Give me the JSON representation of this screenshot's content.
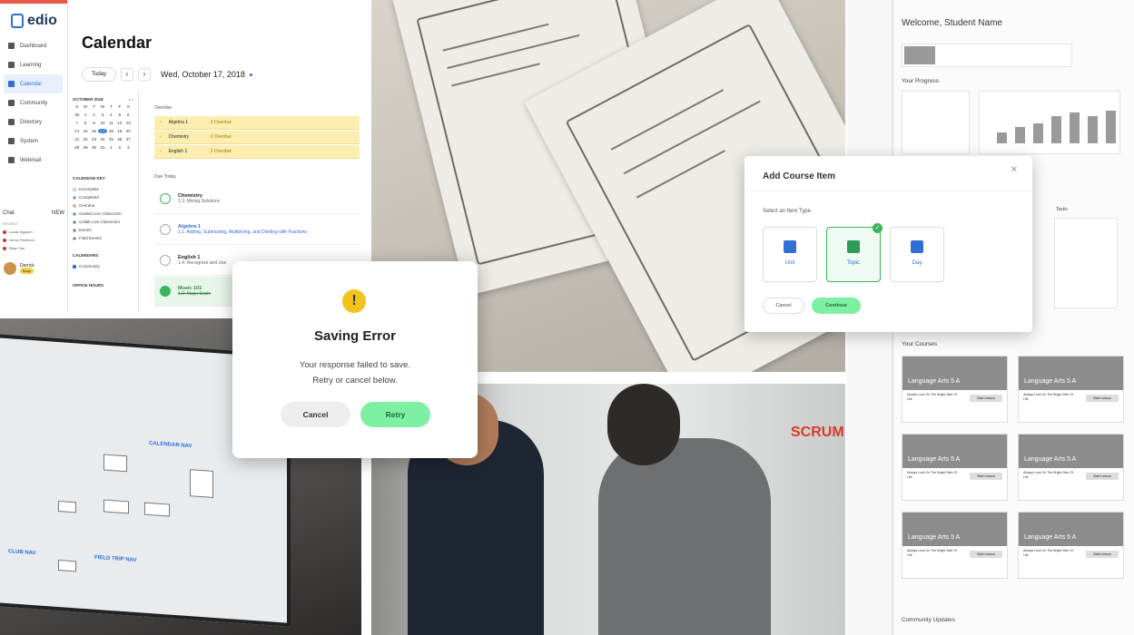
{
  "calendar_app": {
    "brand": "edio",
    "nav": [
      {
        "label": "Dashboard",
        "icon": "dashboard-icon"
      },
      {
        "label": "Learning",
        "icon": "learning-icon"
      },
      {
        "label": "Calendar",
        "icon": "calendar-icon",
        "active": true
      },
      {
        "label": "Community",
        "icon": "community-icon"
      },
      {
        "label": "Directory",
        "icon": "directory-icon"
      },
      {
        "label": "System",
        "icon": "system-icon"
      },
      {
        "label": "Webmail",
        "icon": "webmail-icon"
      }
    ],
    "chat": {
      "label": "Chat",
      "badge": "NEW",
      "recent_label": "RECENT",
      "contacts": [
        "Lucas Nguyen",
        "Jenny Peterson",
        "Ryan Yao"
      ]
    },
    "user": {
      "name": "Derrick",
      "status": "Busy"
    },
    "title": "Calendar",
    "today_button": "Today",
    "current_date": "Wed, October 17, 2018",
    "mini_calendar": {
      "month": "OCTOBER 2018",
      "weekdays": [
        "S",
        "M",
        "T",
        "W",
        "T",
        "F",
        "S"
      ],
      "days": [
        "30",
        "1",
        "2",
        "3",
        "4",
        "5",
        "6",
        "7",
        "8",
        "9",
        "10",
        "11",
        "12",
        "13",
        "14",
        "15",
        "16",
        "17",
        "18",
        "19",
        "20",
        "21",
        "22",
        "23",
        "24",
        "25",
        "26",
        "27",
        "28",
        "29",
        "30",
        "31",
        "1",
        "2",
        "3"
      ],
      "selected": "17"
    },
    "calendar_key": {
      "title": "CALENDAR KEY",
      "items": [
        {
          "label": "Incomplete",
          "color": "#ffffff"
        },
        {
          "label": "Completed",
          "color": "#3bb559"
        },
        {
          "label": "Overdue",
          "color": "#f3c21b"
        },
        {
          "label": "Guided Live Classroom",
          "color": "#2f6fd6"
        },
        {
          "label": "Collab Live Classroom",
          "color": "#2f6fd6"
        },
        {
          "label": "Events",
          "color": "#2f6fd6"
        },
        {
          "label": "Field Events",
          "color": "#666666"
        }
      ]
    },
    "calendars": {
      "title": "CALENDARS",
      "item": "Community"
    },
    "office_hours": "OFFICE HOURS",
    "overdue": {
      "label": "Overdue",
      "items": [
        {
          "course": "Algebra 1",
          "count": "2 Overdue"
        },
        {
          "course": "Chemistry",
          "count": "3 Overdue"
        },
        {
          "course": "English 1",
          "count": "2 Overdue"
        }
      ]
    },
    "due_today": {
      "label": "Due Today",
      "items": [
        {
          "course": "Chemistry",
          "task": "1.3: Mixing Solutions",
          "state": "progress"
        },
        {
          "course": "Algebra 1",
          "task": "1.1: Adding, Subtracting, Multiplying, and Dividing with Fractions",
          "state": "active"
        },
        {
          "course": "English 1",
          "task": "1.4: Recognize and Use",
          "state": "todo"
        },
        {
          "course": "Music 101",
          "task": "1.2: Major Scale",
          "state": "done"
        }
      ]
    }
  },
  "error_dialog": {
    "title": "Saving Error",
    "line1": "Your response failed to save.",
    "line2": "Retry or cancel below.",
    "cancel": "Cancel",
    "retry": "Retry",
    "colors": {
      "retry": "#7ef0a4",
      "cancel": "#eeeeee",
      "icon": "#f3c21b"
    }
  },
  "add_course_modal": {
    "title": "Add Course Item",
    "label": "Select an Item Type",
    "types": [
      {
        "label": "Unit"
      },
      {
        "label": "Topic",
        "selected": true
      },
      {
        "label": "Day"
      }
    ],
    "cancel": "Cancel",
    "continue": "Continue"
  },
  "wireframe": {
    "welcome": "Welcome, Student Name",
    "progress": "Your Progress",
    "courses": "Your Courses",
    "community": "Community Updates",
    "tasks": "Tasks",
    "course_cards": [
      {
        "title": "Language Arts 5 A",
        "lesson": "Always Look On The Bright Side Of Life",
        "button": "Start Lesson"
      },
      {
        "title": "Language Arts 5 A",
        "lesson": "Always Look On The Bright Side Of Life",
        "button": "Start Lesson"
      },
      {
        "title": "Language Arts 5 A",
        "lesson": "Always Look On The Bright Side Of Life",
        "button": "Start Lesson"
      },
      {
        "title": "Language Arts 5 A",
        "lesson": "Always Look On The Bright Side Of Life",
        "button": "Start Lesson"
      },
      {
        "title": "Language Arts 5 A",
        "lesson": "Always Look On The Bright Side Of Life",
        "button": "Start Lesson"
      },
      {
        "title": "Language Arts 5 A",
        "lesson": "Always Look On The Bright Side Of Life",
        "button": "Start Lesson"
      }
    ]
  },
  "photos": {
    "flow_labels": [
      "CALENDAR NAV",
      "CLUB NAV",
      "FIELD TRIP NAV"
    ],
    "whiteboard_text": "SCRUM"
  }
}
